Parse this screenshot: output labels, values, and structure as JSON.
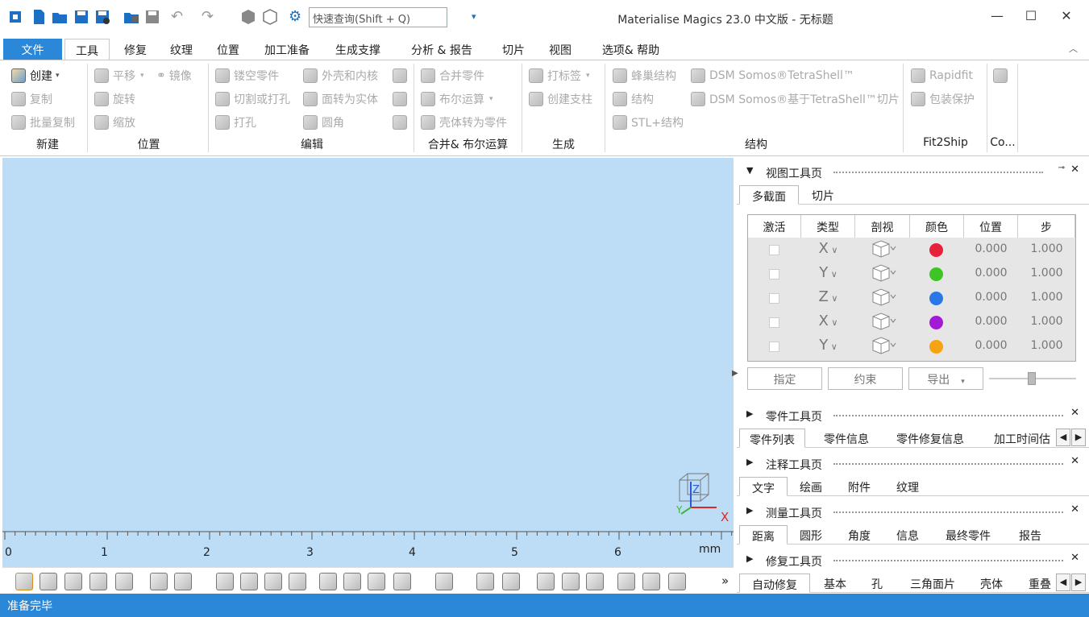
{
  "app_title": "Materialise Magics 23.0 中文版 - 无标题",
  "search": {
    "placeholder": "快速查询(Shift + Q)"
  },
  "window_controls": {
    "minimize": "—",
    "maximize": "☐",
    "close": "✕"
  },
  "tabs": [
    {
      "label": "文件"
    },
    {
      "label": "工具"
    },
    {
      "label": "修复"
    },
    {
      "label": "纹理"
    },
    {
      "label": "位置"
    },
    {
      "label": "加工准备"
    },
    {
      "label": "生成支撑"
    },
    {
      "label": "分析 & 报告"
    },
    {
      "label": "切片"
    },
    {
      "label": "视图"
    },
    {
      "label": "选项& 帮助"
    }
  ],
  "ribbon": {
    "new": {
      "create": "创建",
      "copy": "复制",
      "batch_copy": "批量复制",
      "label": "新建"
    },
    "position": {
      "translate": "平移",
      "mirror": "镜像",
      "rotate": "旋转",
      "scale": "缩放",
      "label": "位置"
    },
    "edit": {
      "hollow": "镂空零件",
      "shell_core": "外壳和内核",
      "cut_punch": "切割或打孔",
      "surface_solid": "面转为实体",
      "punch": "打孔",
      "fillet": "圆角",
      "label": "编辑"
    },
    "merge": {
      "merge_parts": "合并零件",
      "boolean": "布尔运算",
      "shells_to_parts": "壳体转为零件",
      "label": "合并& 布尔运算"
    },
    "generate": {
      "label_tag": "打标签",
      "create_support": "创建支柱",
      "label": "生成"
    },
    "structure": {
      "honeycomb": "蜂巢结构",
      "tetrashell": "DSM Somos®TetraShell™",
      "structure": "结构",
      "tetrashell_slice": "DSM Somos®基于TetraShell™切片",
      "stl_structure": "STL+结构",
      "label": "结构"
    },
    "fit2ship": {
      "rapidfit": "Rapidfit",
      "pack_protect": "包装保护",
      "label": "Fit2Ship"
    },
    "co": {
      "label": "Co..."
    }
  },
  "ruler": {
    "ticks": [
      "0",
      "1",
      "2",
      "3",
      "4",
      "5",
      "6"
    ],
    "unit": "mm"
  },
  "axis": {
    "x": "X",
    "y": "Y",
    "z": "Z"
  },
  "overflow": "»",
  "view_panel": {
    "title": "视图工具页",
    "tabs": [
      "多截面",
      "切片"
    ],
    "columns": [
      "激活",
      "类型",
      "剖视",
      "颜色",
      "位置",
      "步"
    ],
    "rows": [
      {
        "type": "X",
        "color": "#e8213a",
        "position": "0.000",
        "step": "1.000"
      },
      {
        "type": "Y",
        "color": "#3fc425",
        "position": "0.000",
        "step": "1.000"
      },
      {
        "type": "Z",
        "color": "#2a78e6",
        "position": "0.000",
        "step": "1.000"
      },
      {
        "type": "X",
        "color": "#a21ad6",
        "position": "0.000",
        "step": "1.000"
      },
      {
        "type": "Y",
        "color": "#f5a313",
        "position": "0.000",
        "step": "1.000"
      }
    ],
    "buttons": {
      "assign": "指定",
      "constrain": "约束",
      "export": "导出"
    }
  },
  "part_panel": {
    "title": "零件工具页",
    "tabs": [
      "零件列表",
      "零件信息",
      "零件修复信息",
      "加工时间估"
    ]
  },
  "annotation_panel": {
    "title": "注释工具页",
    "tabs": [
      "文字",
      "绘画",
      "附件",
      "纹理"
    ]
  },
  "measure_panel": {
    "title": "测量工具页",
    "tabs": [
      "距离",
      "圆形",
      "角度",
      "信息",
      "最终零件",
      "报告"
    ]
  },
  "repair_panel": {
    "title": "修复工具页",
    "tabs": [
      "自动修复",
      "基本",
      "孔",
      "三角面片",
      "壳体",
      "重叠"
    ]
  },
  "status": "准备完毕",
  "colors": {
    "accent": "#2b87d8",
    "viewport": "#bddcf5"
  }
}
